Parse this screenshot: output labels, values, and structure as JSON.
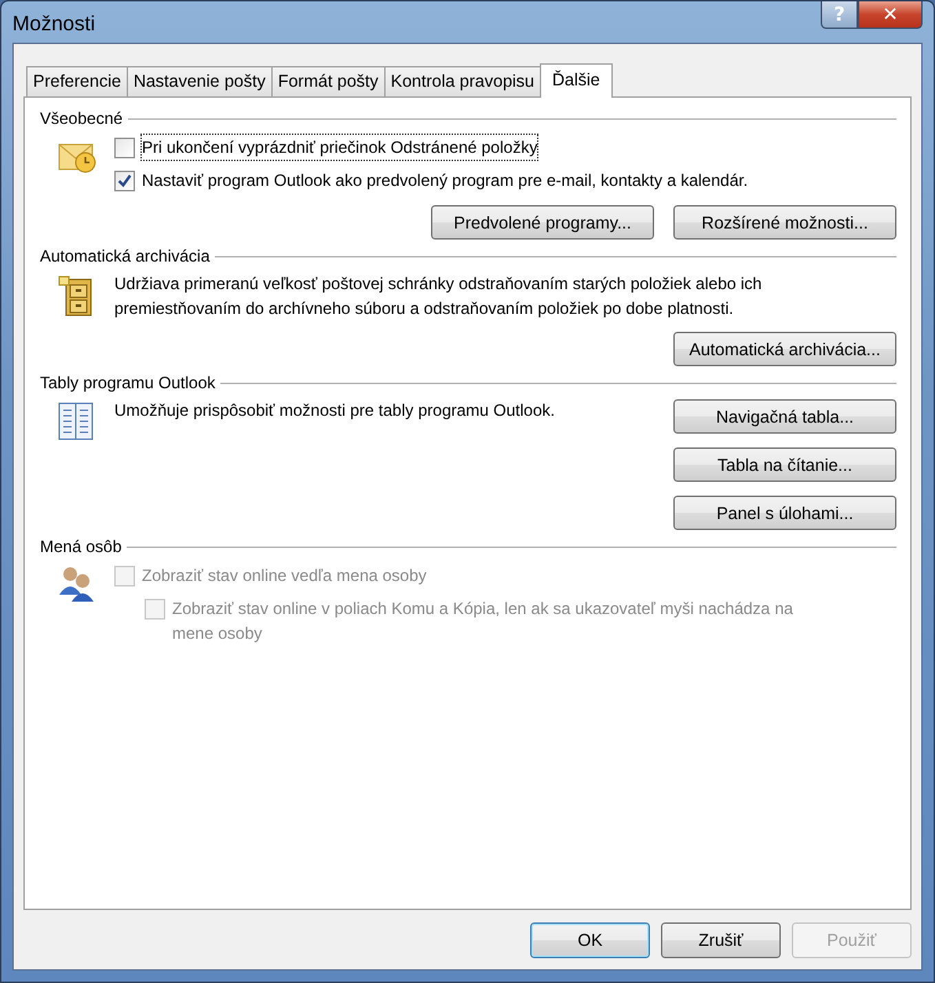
{
  "window": {
    "title": "Možnosti",
    "help_glyph": "?",
    "close_glyph": "✕"
  },
  "tabs": [
    {
      "label": "Preferencie",
      "selected": false
    },
    {
      "label": "Nastavenie pošty",
      "selected": false
    },
    {
      "label": "Formát pošty",
      "selected": false
    },
    {
      "label": "Kontrola pravopisu",
      "selected": false
    },
    {
      "label": "Ďalšie",
      "selected": true
    }
  ],
  "sections": [
    {
      "title": "Všeobecné",
      "kind": "stack",
      "items": [
        {
          "kind": "checkbox",
          "label": "Pri ukončení vyprázdniť priečinok Odstránené položky",
          "checked": false,
          "disabled": false,
          "focused": true
        },
        {
          "kind": "checkbox",
          "label": "Nastaviť program Outlook ako predvolený program pre e-mail, kontakty a kalendár.",
          "checked": true,
          "disabled": false,
          "focused": false
        }
      ],
      "buttons": [
        {
          "label": "Predvolené programy..."
        },
        {
          "label": "Rozšírené možnosti..."
        }
      ]
    },
    {
      "title": "Automatická archivácia",
      "kind": "stack",
      "items": [
        {
          "kind": "text",
          "label": "Udržiava primeranú veľkosť poštovej schránky odstraňovaním starých položiek alebo ich premiestňovaním do archívneho súboru a odstraňovaním položiek po dobe platnosti."
        }
      ],
      "buttons": [
        {
          "label": "Automatická archivácia..."
        }
      ]
    },
    {
      "title": "Tably programu Outlook",
      "kind": "side",
      "items": [
        {
          "kind": "text",
          "label": "Umožňuje prispôsobiť možnosti pre tably programu Outlook."
        }
      ],
      "buttons": [
        {
          "label": "Navigačná tabla..."
        },
        {
          "label": "Tabla na čítanie..."
        },
        {
          "label": "Panel s úlohami..."
        }
      ]
    },
    {
      "title": "Mená osôb",
      "kind": "stack",
      "items": [
        {
          "kind": "checkbox",
          "label": "Zobraziť stav online vedľa mena osoby",
          "checked": false,
          "disabled": true,
          "focused": false,
          "children": [
            {
              "label": "Zobraziť stav online v poliach Komu a Kópia, len ak sa ukazovateľ myši nachádza na mene osoby",
              "checked": false,
              "disabled": true,
              "focused": false
            }
          ]
        }
      ]
    }
  ],
  "footer": [
    {
      "label": "OK",
      "default": true,
      "disabled": false
    },
    {
      "label": "Zrušiť",
      "default": false,
      "disabled": false
    },
    {
      "label": "Použiť",
      "default": false,
      "disabled": true
    }
  ]
}
